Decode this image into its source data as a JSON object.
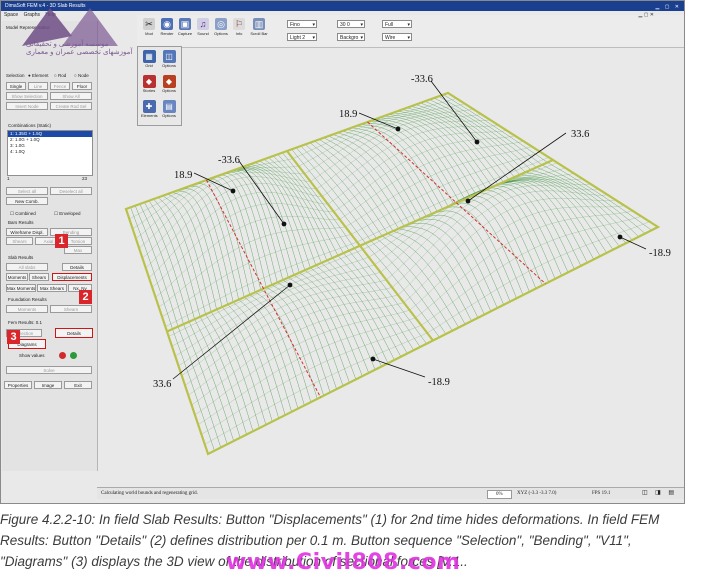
{
  "app": {
    "title": "DimaSoft FEM v.4 - 3D Slab Results",
    "menu": [
      "Space",
      "Graphs",
      "Help"
    ]
  },
  "toolbar": {
    "buttons": [
      {
        "label": "Mod",
        "icon": "pointer-icon"
      },
      {
        "label": "Render",
        "icon": "render-icon"
      },
      {
        "label": "Capture",
        "icon": "capture-icon"
      },
      {
        "label": "Sound",
        "icon": "sound-icon"
      },
      {
        "label": "Options",
        "icon": "options-icon"
      },
      {
        "label": "Info",
        "icon": "info-icon"
      },
      {
        "label": "Scroll Bar",
        "icon": "scrollbar-icon"
      }
    ],
    "selects": [
      "Fino",
      "Light 2",
      "30 0",
      "Backgro",
      "Full",
      "Wire"
    ]
  },
  "palette": {
    "buttons": [
      {
        "label": "Grid",
        "icon": "grid-icon"
      },
      {
        "label": "Options",
        "icon": "options-icon"
      },
      {
        "label": "Stories",
        "icon": "stories-icon"
      },
      {
        "label": "Options",
        "icon": "options-icon"
      },
      {
        "label": "Elements",
        "icon": "elements-icon"
      },
      {
        "label": "Options",
        "icon": "options-icon"
      }
    ]
  },
  "left_panel": {
    "model_representation": "Model Representation",
    "selection_label": "Selection",
    "selection_modes": [
      "Element",
      "Rod",
      "Node"
    ],
    "single_buttons": [
      "Single",
      "Line",
      "Fence",
      "Floor"
    ],
    "info_buttons": [
      "Show Selection",
      "Show All"
    ],
    "insert_buttons": [
      "Insert Node",
      "Create Rod Sel"
    ],
    "combinations_label": "Combinations (Static)",
    "combinations": [
      "1: 1.35G + 1.5Q",
      "2: 1.0G + 1.0Q",
      "3: 1.0G",
      "4: 1.0Q"
    ],
    "combo_page_from": "1",
    "combo_page_to": "23",
    "combo_buttons": [
      "New Comb.",
      "Select all",
      "Deselect all"
    ],
    "combined_label": "Combined",
    "enveloped_label": "Enveloped",
    "bars_results_label": "Bars Results",
    "bars_buttons": [
      "Wireframe Displ.",
      "Bending",
      "Shears",
      "Axial",
      "Torsion",
      "Max"
    ],
    "slab_results_label": "Slab Results",
    "slab_buttons": [
      "All slabs",
      "Details",
      "Moments",
      "Shears",
      "Displacements",
      "Max Moments",
      "Max Shears",
      "Nx, Ny"
    ],
    "foundation_label": "Foundation Results",
    "foundation_buttons": [
      "Moments",
      "Shears"
    ],
    "fem_results_label": "Fem Results: 0.1",
    "fem_buttons": [
      "Selection",
      "Details",
      "Diagrams"
    ],
    "show_values_label": "Show values",
    "bottom_buttons": [
      "Solve",
      "Properties",
      "Image",
      "Exit"
    ]
  },
  "badges": [
    "1",
    "2",
    "3"
  ],
  "plot": {
    "labels": [
      {
        "text": "-33.6"
      },
      {
        "text": "18.9"
      },
      {
        "text": "33.6"
      },
      {
        "text": "-33.6"
      },
      {
        "text": "18.9"
      },
      {
        "text": "-18.9"
      },
      {
        "text": "33.6"
      },
      {
        "text": "-18.9"
      }
    ]
  },
  "status_bar": {
    "message": "Calculating world bounds and regenerating grid.",
    "progress": "0%",
    "coords": "XYZ (-3.3 -3.3 7.0)",
    "fps": "FPS 19.1"
  },
  "caption": {
    "line1": "Figure 4.2.2-10: In field Slab Results: Button \"Displacements\" (1) for 2nd time hides deformations. In field FEM",
    "line2": "Results: Button \"Details\" (2) defines distribution per 0.1 m. Button sequence \"Selection\", \"Bending\", \"V11\",",
    "line3": "\"Diagrams\" (3) displays the 3D view of the distribution of sectional forces [V.1.."
  },
  "watermark": {
    "logo_line1": "موسسه آموزشی و تحقیقاتی",
    "logo_line2": "آموزشهای تخصصی عمران و معماری",
    "site": "www.Civil808.com"
  },
  "colors": {
    "mesh_green": "#2e8c2e",
    "slab_border": "#b8c24a",
    "dash_red": "#d23030",
    "badge_red": "#d9262a",
    "selected_blue": "#1c4aa6",
    "watermark_pink": "#e030e0"
  }
}
